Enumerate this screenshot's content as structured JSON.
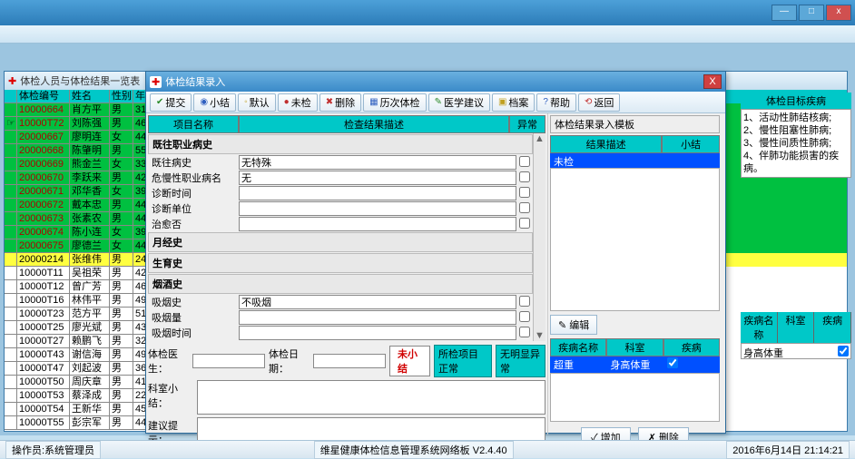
{
  "window": {
    "min": "—",
    "max": "□",
    "close": "x"
  },
  "list_window": {
    "title": "体检人员与体检结果一览表",
    "columns": {
      "id": "体检编号",
      "name": "姓名",
      "sex": "性别",
      "age": "年龄"
    },
    "rows": [
      {
        "id": "10000664",
        "name": "肖方平",
        "sex": "男",
        "age": "31",
        "cls": "green"
      },
      {
        "id": "10000T72",
        "name": "刘陈强",
        "sex": "男",
        "age": "46",
        "cls": "green",
        "ptr": true,
        "redid": true
      },
      {
        "id": "20000667",
        "name": "廖明连",
        "sex": "女",
        "age": "44",
        "cls": "green"
      },
      {
        "id": "20000668",
        "name": "陈肇明",
        "sex": "男",
        "age": "55",
        "cls": "green"
      },
      {
        "id": "20000669",
        "name": "熊金兰",
        "sex": "女",
        "age": "33",
        "cls": "green"
      },
      {
        "id": "20000670",
        "name": "李跃来",
        "sex": "男",
        "age": "42",
        "cls": "green"
      },
      {
        "id": "20000671",
        "name": "邓华香",
        "sex": "女",
        "age": "39",
        "cls": "green"
      },
      {
        "id": "20000672",
        "name": "戴本忠",
        "sex": "男",
        "age": "44",
        "cls": "green"
      },
      {
        "id": "20000673",
        "name": "张素农",
        "sex": "男",
        "age": "44",
        "cls": "green"
      },
      {
        "id": "20000674",
        "name": "陈小连",
        "sex": "女",
        "age": "39",
        "cls": "green"
      },
      {
        "id": "20000675",
        "name": "廖德兰",
        "sex": "女",
        "age": "44",
        "cls": "green"
      },
      {
        "id": "20000214",
        "name": "张维伟",
        "sex": "男",
        "age": "24",
        "cls": "yellow"
      },
      {
        "id": "10000T11",
        "name": "吴祖荣",
        "sex": "男",
        "age": "42",
        "cls": ""
      },
      {
        "id": "10000T12",
        "name": "曾广芳",
        "sex": "男",
        "age": "46",
        "cls": ""
      },
      {
        "id": "10000T16",
        "name": "林伟平",
        "sex": "男",
        "age": "49",
        "cls": ""
      },
      {
        "id": "10000T23",
        "name": "范方平",
        "sex": "男",
        "age": "51",
        "cls": ""
      },
      {
        "id": "10000T25",
        "name": "廖光斌",
        "sex": "男",
        "age": "43",
        "cls": ""
      },
      {
        "id": "10000T27",
        "name": "赖鹏飞",
        "sex": "男",
        "age": "32",
        "cls": ""
      },
      {
        "id": "10000T43",
        "name": "谢信海",
        "sex": "男",
        "age": "49",
        "cls": ""
      },
      {
        "id": "10000T47",
        "name": "刘起波",
        "sex": "男",
        "age": "36",
        "cls": ""
      },
      {
        "id": "10000T50",
        "name": "周庆章",
        "sex": "男",
        "age": "41",
        "cls": ""
      },
      {
        "id": "10000T53",
        "name": "蔡泽成",
        "sex": "男",
        "age": "22",
        "cls": ""
      },
      {
        "id": "10000T54",
        "name": "王新华",
        "sex": "男",
        "age": "45",
        "cls": ""
      },
      {
        "id": "10000T55",
        "name": "彭宗军",
        "sex": "男",
        "age": "44",
        "cls": ""
      }
    ]
  },
  "entry_window": {
    "title": "体检结果录入",
    "toolbar": [
      "提交",
      "小结",
      "默认",
      "未检",
      "删除",
      "历次体检",
      "医学建议",
      "档案",
      "帮助",
      "返回"
    ],
    "subhead": {
      "c1": "项目名称",
      "c2": "检查结果描述",
      "c3": "异常"
    },
    "sections": {
      "s1": "既往职业病史",
      "fields1": [
        {
          "label": "既往病史",
          "value": "无特殊"
        },
        {
          "label": "危慢性职业病名",
          "value": "无"
        },
        {
          "label": "诊断时间",
          "value": ""
        },
        {
          "label": "诊断单位",
          "value": ""
        },
        {
          "label": "治愈否",
          "value": ""
        }
      ],
      "s2": "月经史",
      "s3": "生育史",
      "s4": "烟酒史",
      "fields4": [
        {
          "label": "吸烟史",
          "value": "不吸烟"
        },
        {
          "label": "吸烟量",
          "value": ""
        },
        {
          "label": "吸烟时间",
          "value": ""
        }
      ]
    },
    "bottom": {
      "doctor_label": "体检医生：",
      "date_label": "体检日期：",
      "status": "未小结",
      "btn1": "所检项目正常",
      "btn2": "无明显异常",
      "summary_label": "科室小结：",
      "suggest_label": "建议提示："
    },
    "template_panel": {
      "title": "体检结果录入模板",
      "head": {
        "a": "结果描述",
        "b": "小结"
      },
      "row": "未检",
      "edit_btn": "编辑",
      "dis_head": {
        "a": "疾病名称",
        "b": "科室",
        "c": "疾病"
      },
      "dis_row": {
        "a": "超重",
        "b": "身高体重",
        "chk": true
      },
      "add_btn": "增加",
      "del_btn": "删除"
    }
  },
  "right_targets": {
    "title": "体检目标疾病",
    "items": [
      "1、活动性肺结核病;",
      "2、慢性阻塞性肺病;",
      "3、慢性间质性肺病;",
      "4、伴肺功能损害的疾病。"
    ]
  },
  "right_small": {
    "cols": [
      "疾病名称",
      "科室",
      "疾病"
    ],
    "row": {
      "b": "身高体重",
      "chk": true
    }
  },
  "statusbar": {
    "left": "操作员:系统管理员",
    "mid": "维星健康体检信息管理系统网络板 V2.4.40",
    "right": "2016年6月14日 21:14:21"
  }
}
